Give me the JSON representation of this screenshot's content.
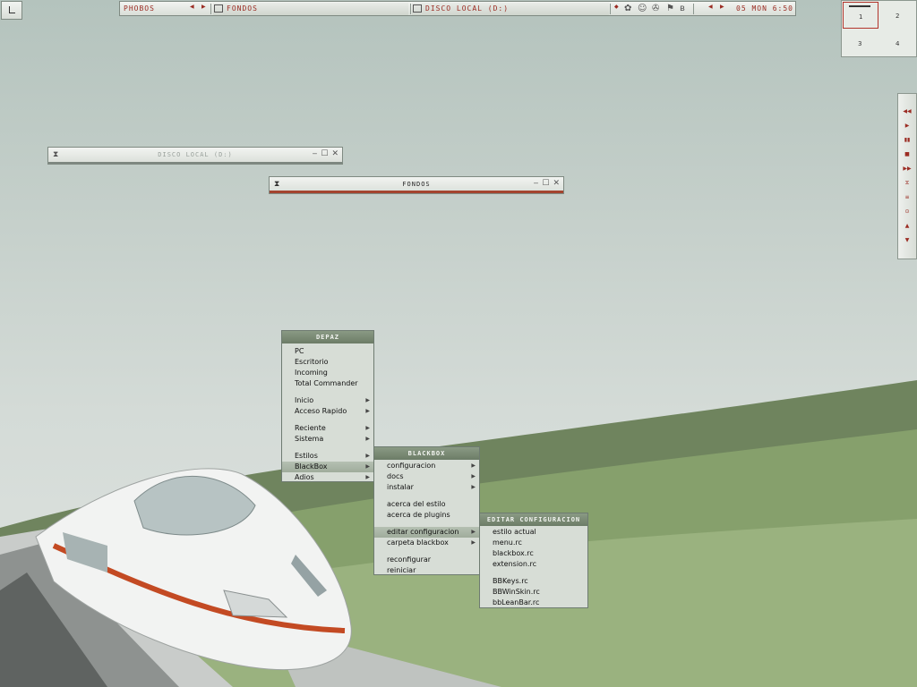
{
  "toolbar": {
    "workspace": "PHOBOS",
    "task1": "FONDOS",
    "task2": "DISCO LOCAL (D:)",
    "clock": "05 MON 6:50"
  },
  "pager": {
    "desks": [
      "1",
      "2",
      "3",
      "4"
    ]
  },
  "windows": {
    "disco": {
      "title": "DISCO LOCAL (D:)"
    },
    "fondos": {
      "title": "FONDOS"
    }
  },
  "menu_depaz": {
    "title": "DEPAZ",
    "items": [
      "PC",
      "Escritorio",
      "Incoming",
      "Total Commander",
      "Inicio",
      "Acceso Rapido",
      "Reciente",
      "Sistema",
      "Estilos",
      "BlackBox",
      "Adios"
    ]
  },
  "menu_blackbox": {
    "title": "BLACKBOX",
    "items": [
      "configuracion",
      "docs",
      "instalar",
      "acerca del estilo",
      "acerca de plugins",
      "editar configuracion",
      "carpeta blackbox",
      "reconfigurar",
      "reiniciar"
    ]
  },
  "menu_editar": {
    "title": "EDITAR CONFIGURACION",
    "items": [
      "estilo actual",
      "menu.rc",
      "blackbox.rc",
      "extension.rc",
      "BBKeys.rc",
      "BBWinSkin.rc",
      "bbLeanBar.rc"
    ]
  },
  "colors": {
    "accent": "#9b2b22",
    "menu_header": "#7a8a75",
    "panel": "#e3e7e2"
  },
  "icons": [
    "corner-button-icon",
    "drive-icon",
    "folder-icon",
    "tray-icon",
    "bluetooth-icon",
    "play-icon",
    "pause-icon",
    "stop-icon"
  ]
}
